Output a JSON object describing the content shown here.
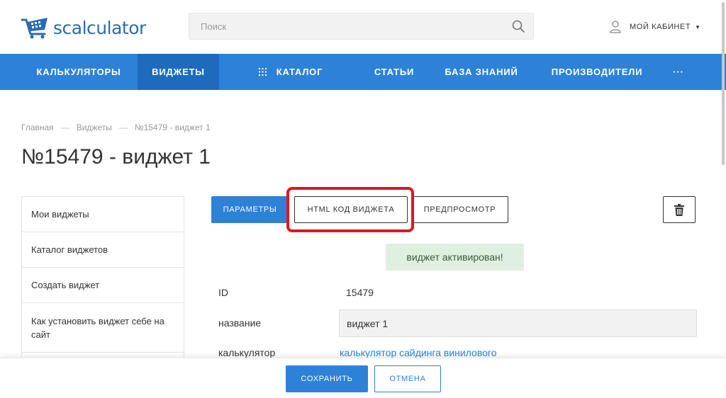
{
  "header": {
    "logo_text": "scalculator",
    "search_placeholder": "Поиск",
    "cabinet_label": "МОЙ КАБИНЕТ"
  },
  "nav": {
    "items": [
      {
        "label": "КАЛЬКУЛЯТОРЫ"
      },
      {
        "label": "ВИДЖЕТЫ"
      },
      {
        "label": "КАТАЛОГ"
      },
      {
        "label": "СТАТЬИ"
      },
      {
        "label": "БАЗА ЗНАНИЙ"
      },
      {
        "label": "ПРОИЗВОДИТЕЛИ"
      },
      {
        "label": "···"
      }
    ]
  },
  "breadcrumb": {
    "items": [
      "Главная",
      "Виджеты",
      "№15479 - виджет 1"
    ],
    "separator": "—"
  },
  "page": {
    "title": "№15479 - виджет 1"
  },
  "sidebar": {
    "items": [
      {
        "label": "Мои виджеты"
      },
      {
        "label": "Каталог виджетов"
      },
      {
        "label": "Создать виджет"
      },
      {
        "label": "Как установить виджет себе на сайт"
      }
    ]
  },
  "tabs": {
    "params": "ПАРАМЕТРЫ",
    "html_code": "HTML КОД ВИДЖЕТА",
    "preview": "ПРЕДПРОСМОТР"
  },
  "alert": {
    "text": "виджет активирован!"
  },
  "form": {
    "id_label": "ID",
    "id_value": "15479",
    "name_label": "название",
    "name_value": "виджет 1",
    "calc_label": "калькулятор",
    "calc_value": "калькулятор сайдинга винилового"
  },
  "footer": {
    "save": "СОХРАНИТЬ",
    "cancel": "ОТМЕНА"
  },
  "colors": {
    "brand_blue": "#2d82d8",
    "nav_active": "#1e6bbd",
    "alert_bg": "#dff0e1",
    "highlight_red": "#e0171a"
  }
}
